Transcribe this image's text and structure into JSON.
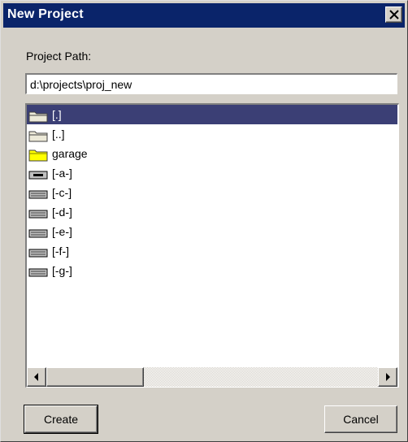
{
  "window": {
    "title": "New Project",
    "close_label": "×"
  },
  "path": {
    "label": "Project Path:",
    "value": "d:\\projects\\proj_new"
  },
  "list": {
    "items": [
      {
        "label": "[.]",
        "icon": "folder-closed-icon",
        "selected": true
      },
      {
        "label": "[..]",
        "icon": "folder-closed-icon",
        "selected": false
      },
      {
        "label": "garage",
        "icon": "folder-yellow-icon",
        "selected": false
      },
      {
        "label": "[-a-]",
        "icon": "floppy-drive-icon",
        "selected": false
      },
      {
        "label": "[-c-]",
        "icon": "hard-drive-icon",
        "selected": false
      },
      {
        "label": "[-d-]",
        "icon": "hard-drive-icon",
        "selected": false
      },
      {
        "label": "[-e-]",
        "icon": "hard-drive-icon",
        "selected": false
      },
      {
        "label": "[-f-]",
        "icon": "hard-drive-icon",
        "selected": false
      },
      {
        "label": "[-g-]",
        "icon": "hard-drive-icon",
        "selected": false
      }
    ]
  },
  "buttons": {
    "create": "Create",
    "cancel": "Cancel"
  },
  "colors": {
    "titlebar": "#0a246a",
    "selection": "#3b3f75",
    "face": "#d4d0c8"
  }
}
